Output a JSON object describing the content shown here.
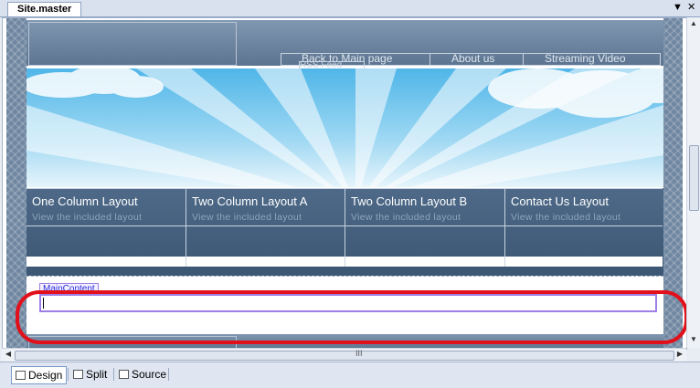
{
  "document_tab": {
    "title": "Site.master"
  },
  "window_controls": {
    "dropdown_glyph": "▼",
    "close_glyph": "✕"
  },
  "top_nav": {
    "items": [
      "Back to Main page",
      "About us",
      "Streaming Video"
    ],
    "overflow_text": "RSS Feed"
  },
  "content_menu": {
    "items": [
      {
        "title": "One Column Layout",
        "subtitle": "View the included layout"
      },
      {
        "title": "Two Column Layout A",
        "subtitle": "View the included layout"
      },
      {
        "title": "Two Column Layout B",
        "subtitle": "View the included layout"
      },
      {
        "title": "Contact Us Layout",
        "subtitle": "View the included layout"
      }
    ]
  },
  "content_placeholder": {
    "label": "MainContent"
  },
  "scrollbar": {
    "grip_glyph": "III"
  },
  "view_switcher": {
    "design_label": "Design",
    "split_label": "Split",
    "source_label": "Source",
    "active": "design"
  },
  "colors": {
    "highlight": "#e1101a",
    "placeholder_border": "#9d7fe6",
    "menu_bg": "#3d5875"
  }
}
